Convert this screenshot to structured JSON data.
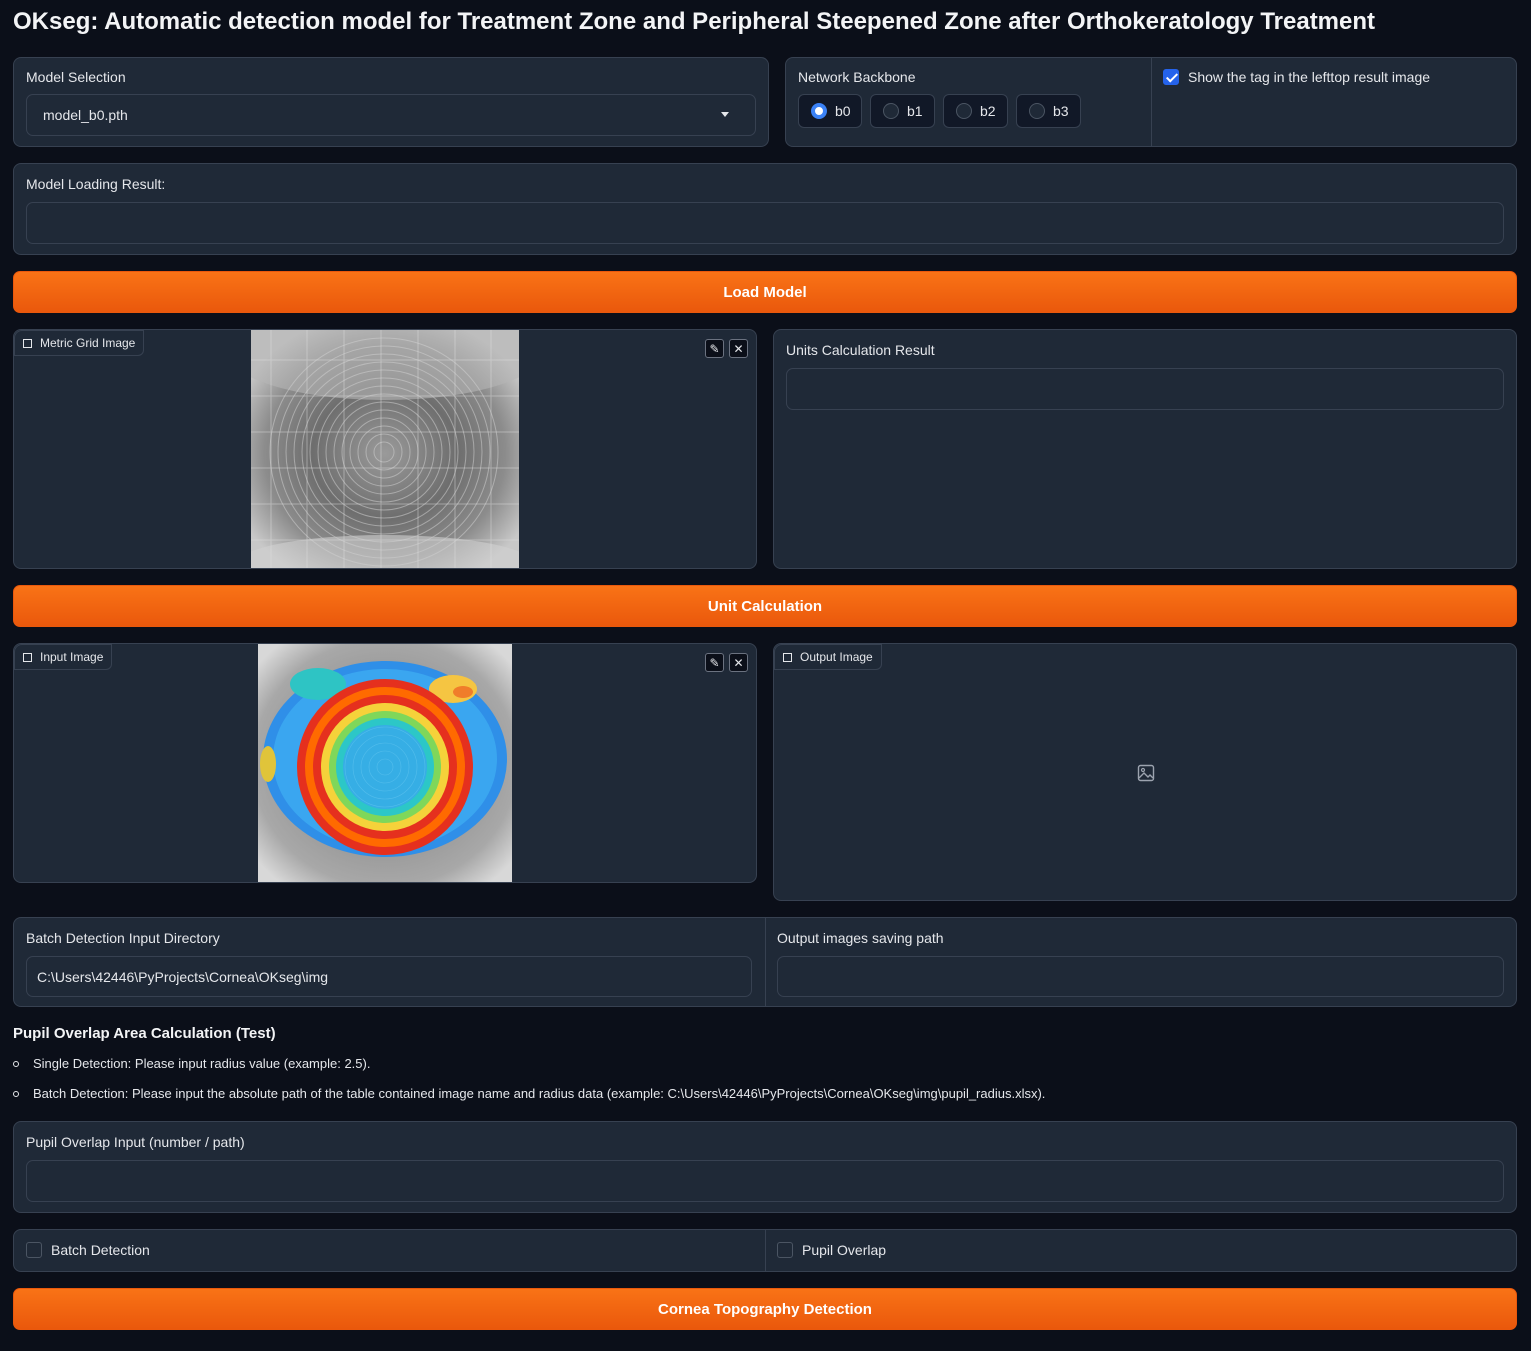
{
  "title": "OKseg: Automatic detection model for Treatment Zone and Peripheral Steepened Zone after Orthokeratology Treatment",
  "model_selection": {
    "label": "Model Selection",
    "value": "model_b0.pth"
  },
  "network_backbone": {
    "label": "Network Backbone",
    "options": [
      "b0",
      "b1",
      "b2",
      "b3"
    ],
    "selected": "b0"
  },
  "show_tag": {
    "label": "Show the tag in the lefttop result image",
    "checked": true
  },
  "model_loading_result": {
    "label": "Model Loading Result:",
    "value": ""
  },
  "load_model_button": "Load Model",
  "metric_grid_image": {
    "label": "Metric Grid Image"
  },
  "units_calculation_result": {
    "label": "Units Calculation Result",
    "value": ""
  },
  "unit_calculation_button": "Unit Calculation",
  "input_image": {
    "label": "Input Image"
  },
  "output_image": {
    "label": "Output Image"
  },
  "batch_input_dir": {
    "label": "Batch Detection Input Directory",
    "value": "C:\\Users\\42446\\PyProjects\\Cornea\\OKseg\\img"
  },
  "output_saving_path": {
    "label": "Output images saving path",
    "value": ""
  },
  "pupil_section": {
    "heading": "Pupil Overlap Area Calculation (Test)",
    "bullets": [
      "Single Detection: Please input radius value (example: 2.5).",
      "Batch Detection: Please input the absolute path of the table contained image name and radius data (example: C:\\Users\\42446\\PyProjects\\Cornea\\OKseg\\img\\pupil_radius.xlsx)."
    ]
  },
  "pupil_overlap_input": {
    "label": "Pupil Overlap Input (number / path)",
    "value": ""
  },
  "batch_detection_checkbox": {
    "label": "Batch Detection",
    "checked": false
  },
  "pupil_overlap_checkbox": {
    "label": "Pupil Overlap",
    "checked": false
  },
  "detect_button": "Cornea Topography Detection",
  "colors": {
    "accent": "#f97316",
    "panel": "#1f2937",
    "background": "#0b0f19",
    "selected": "#3b82f6"
  },
  "icons": [
    "chevron-down-icon",
    "image-icon",
    "edit-icon",
    "close-icon",
    "image-placeholder-icon"
  ]
}
